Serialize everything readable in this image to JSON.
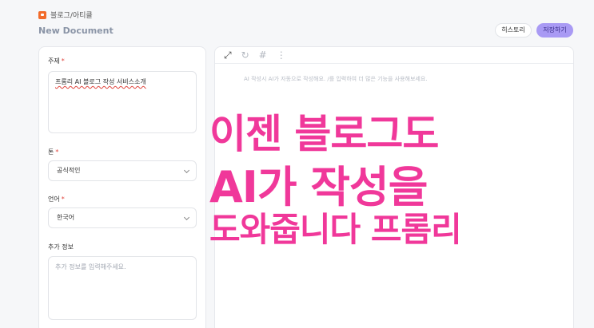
{
  "header": {
    "breadcrumb": "블로그/아티클",
    "doc_title": "New Document",
    "history_label": "히스토리",
    "save_label": "저장하기"
  },
  "form": {
    "subject_label": "주제",
    "subject_value": "프롬리 AI 블로그 작성 서비스소개",
    "tone_label": "톤",
    "tone_value": "공식적인",
    "language_label": "언어",
    "language_value": "한국어",
    "extra_label": "추가 정보",
    "extra_placeholder": "추가 정보를 입력해주세요."
  },
  "editor": {
    "placeholder": "AI 작성시 AI가 자동으로 작성해요. /를 입력하여 더 많은 기능을 사용해보세요.",
    "tools": [
      "expand-icon",
      "refresh-icon",
      "hash-icon",
      "more-vertical-icon"
    ]
  },
  "overlay": {
    "line1": "이젠 블로그도",
    "line2": "AI가 작성을",
    "line3": "도와줍니다 프롬리"
  },
  "colors": {
    "accent": "#a99af4",
    "overlay_pink": "#f0389a",
    "required": "#e0443c"
  }
}
